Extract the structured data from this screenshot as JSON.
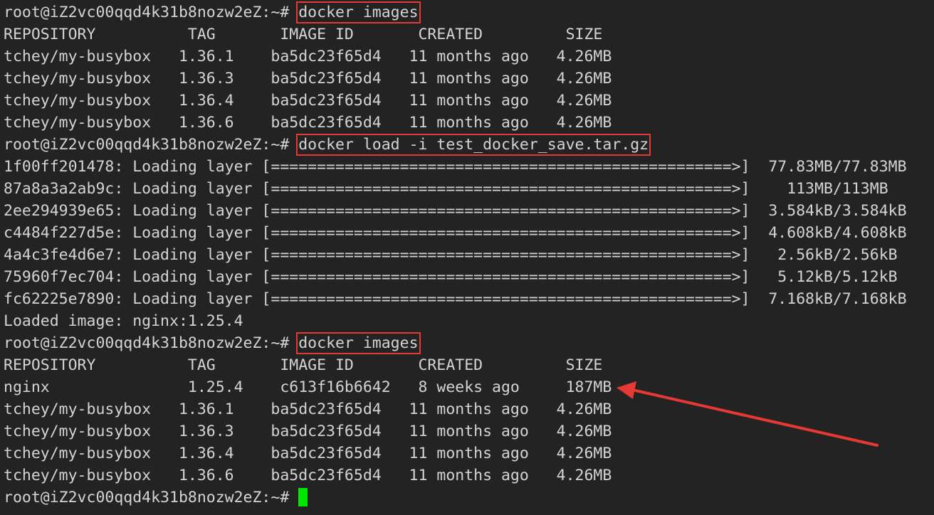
{
  "prompt": "root@iZ2vc00qqd4k31b8nozw2eZ:~#",
  "commands": {
    "first": "docker images",
    "second": "docker load -i test_docker_save.tar.gz",
    "third": "docker images"
  },
  "table_header": "REPOSITORY          TAG       IMAGE ID       CREATED         SIZE",
  "first_listing": [
    "tchey/my-busybox   1.36.1    ba5dc23f65d4   11 months ago   4.26MB",
    "tchey/my-busybox   1.36.3    ba5dc23f65d4   11 months ago   4.26MB",
    "tchey/my-busybox   1.36.4    ba5dc23f65d4   11 months ago   4.26MB",
    "tchey/my-busybox   1.36.6    ba5dc23f65d4   11 months ago   4.26MB"
  ],
  "load_progress": [
    "1f00ff201478: Loading layer [==================================================>]  77.83MB/77.83MB",
    "87a8a3a2ab9c: Loading layer [==================================================>]    113MB/113MB",
    "2ee294939e65: Loading layer [==================================================>]  3.584kB/3.584kB",
    "c4484f227d5e: Loading layer [==================================================>]  4.608kB/4.608kB",
    "4a4c3fe4d6e7: Loading layer [==================================================>]   2.56kB/2.56kB",
    "75960f7ec704: Loading layer [==================================================>]   5.12kB/5.12kB",
    "fc62225e7890: Loading layer [==================================================>]  7.168kB/7.168kB"
  ],
  "loaded_message": "Loaded image: nginx:1.25.4",
  "second_listing": [
    "nginx               1.25.4    c613f16b6642   8 weeks ago     187MB",
    "tchey/my-busybox   1.36.1    ba5dc23f65d4   11 months ago   4.26MB",
    "tchey/my-busybox   1.36.3    ba5dc23f65d4   11 months ago   4.26MB",
    "tchey/my-busybox   1.36.4    ba5dc23f65d4   11 months ago   4.26MB",
    "tchey/my-busybox   1.36.6    ba5dc23f65d4   11 months ago   4.26MB"
  ],
  "colors": {
    "background": "#232323",
    "text": "#d4d4d4",
    "highlight": "#e53935",
    "cursor": "#00e600"
  }
}
